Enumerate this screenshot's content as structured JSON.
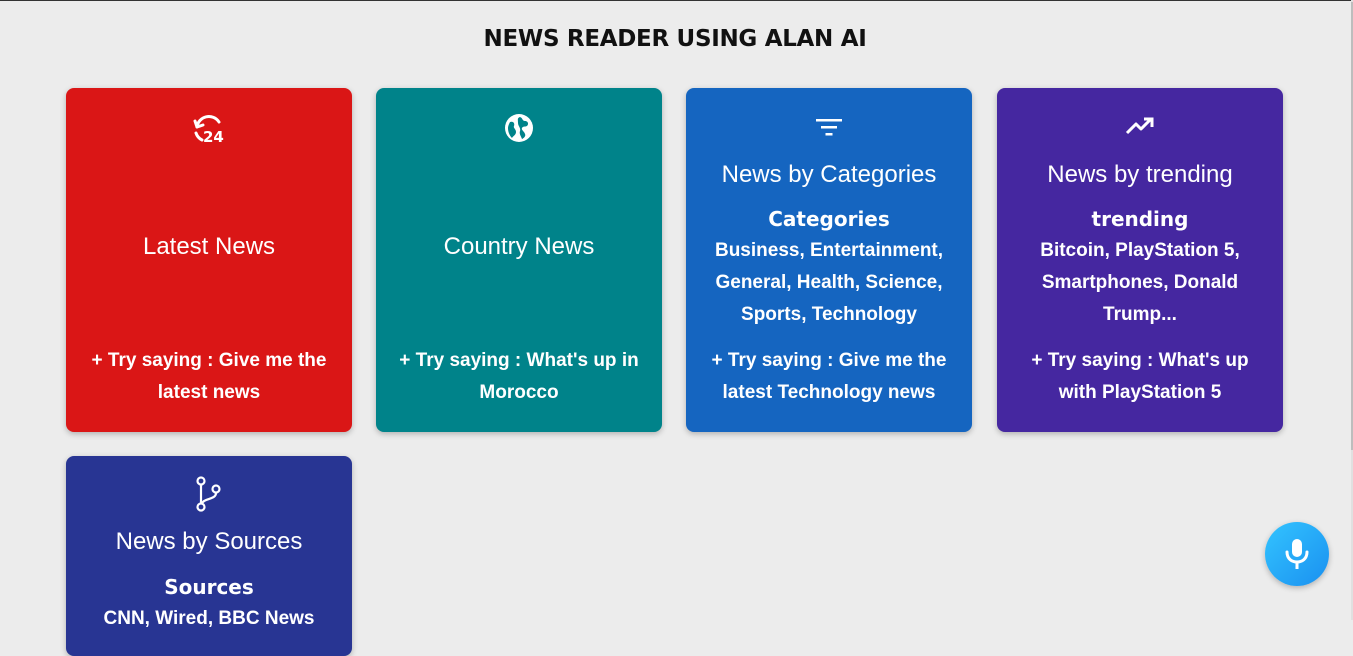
{
  "header": {
    "title": "NEWS READER USING ALAN AI"
  },
  "cards": [
    {
      "icon": "24-hours-icon",
      "color": "#da1616",
      "title": "Latest News",
      "hint": "+ Try saying : Give me the latest news"
    },
    {
      "icon": "globe-icon",
      "color": "#00838a",
      "title": "Country News",
      "hint": "+ Try saying : What's up in Morocco"
    },
    {
      "icon": "filter-icon",
      "color": "#1565c0",
      "title": "News by Categories",
      "subhead": "Categories",
      "list": "Business, Entertainment, General, Health, Science, Sports, Technology",
      "hint": "+ Try saying : Give me the latest Technology news"
    },
    {
      "icon": "trending-icon",
      "color": "#4527a0",
      "title": "News by trending",
      "subhead": "trending",
      "list": "Bitcoin, PlayStation 5, Smartphones, Donald Trump...",
      "hint": "+ Try saying : What's up with PlayStation 5"
    },
    {
      "icon": "fork-icon",
      "color": "#283593",
      "title": "News by Sources",
      "subhead": "Sources",
      "list": "CNN, Wired, BBC News"
    }
  ],
  "mic": {
    "icon": "microphone-icon",
    "color": "#1e9ff5"
  }
}
